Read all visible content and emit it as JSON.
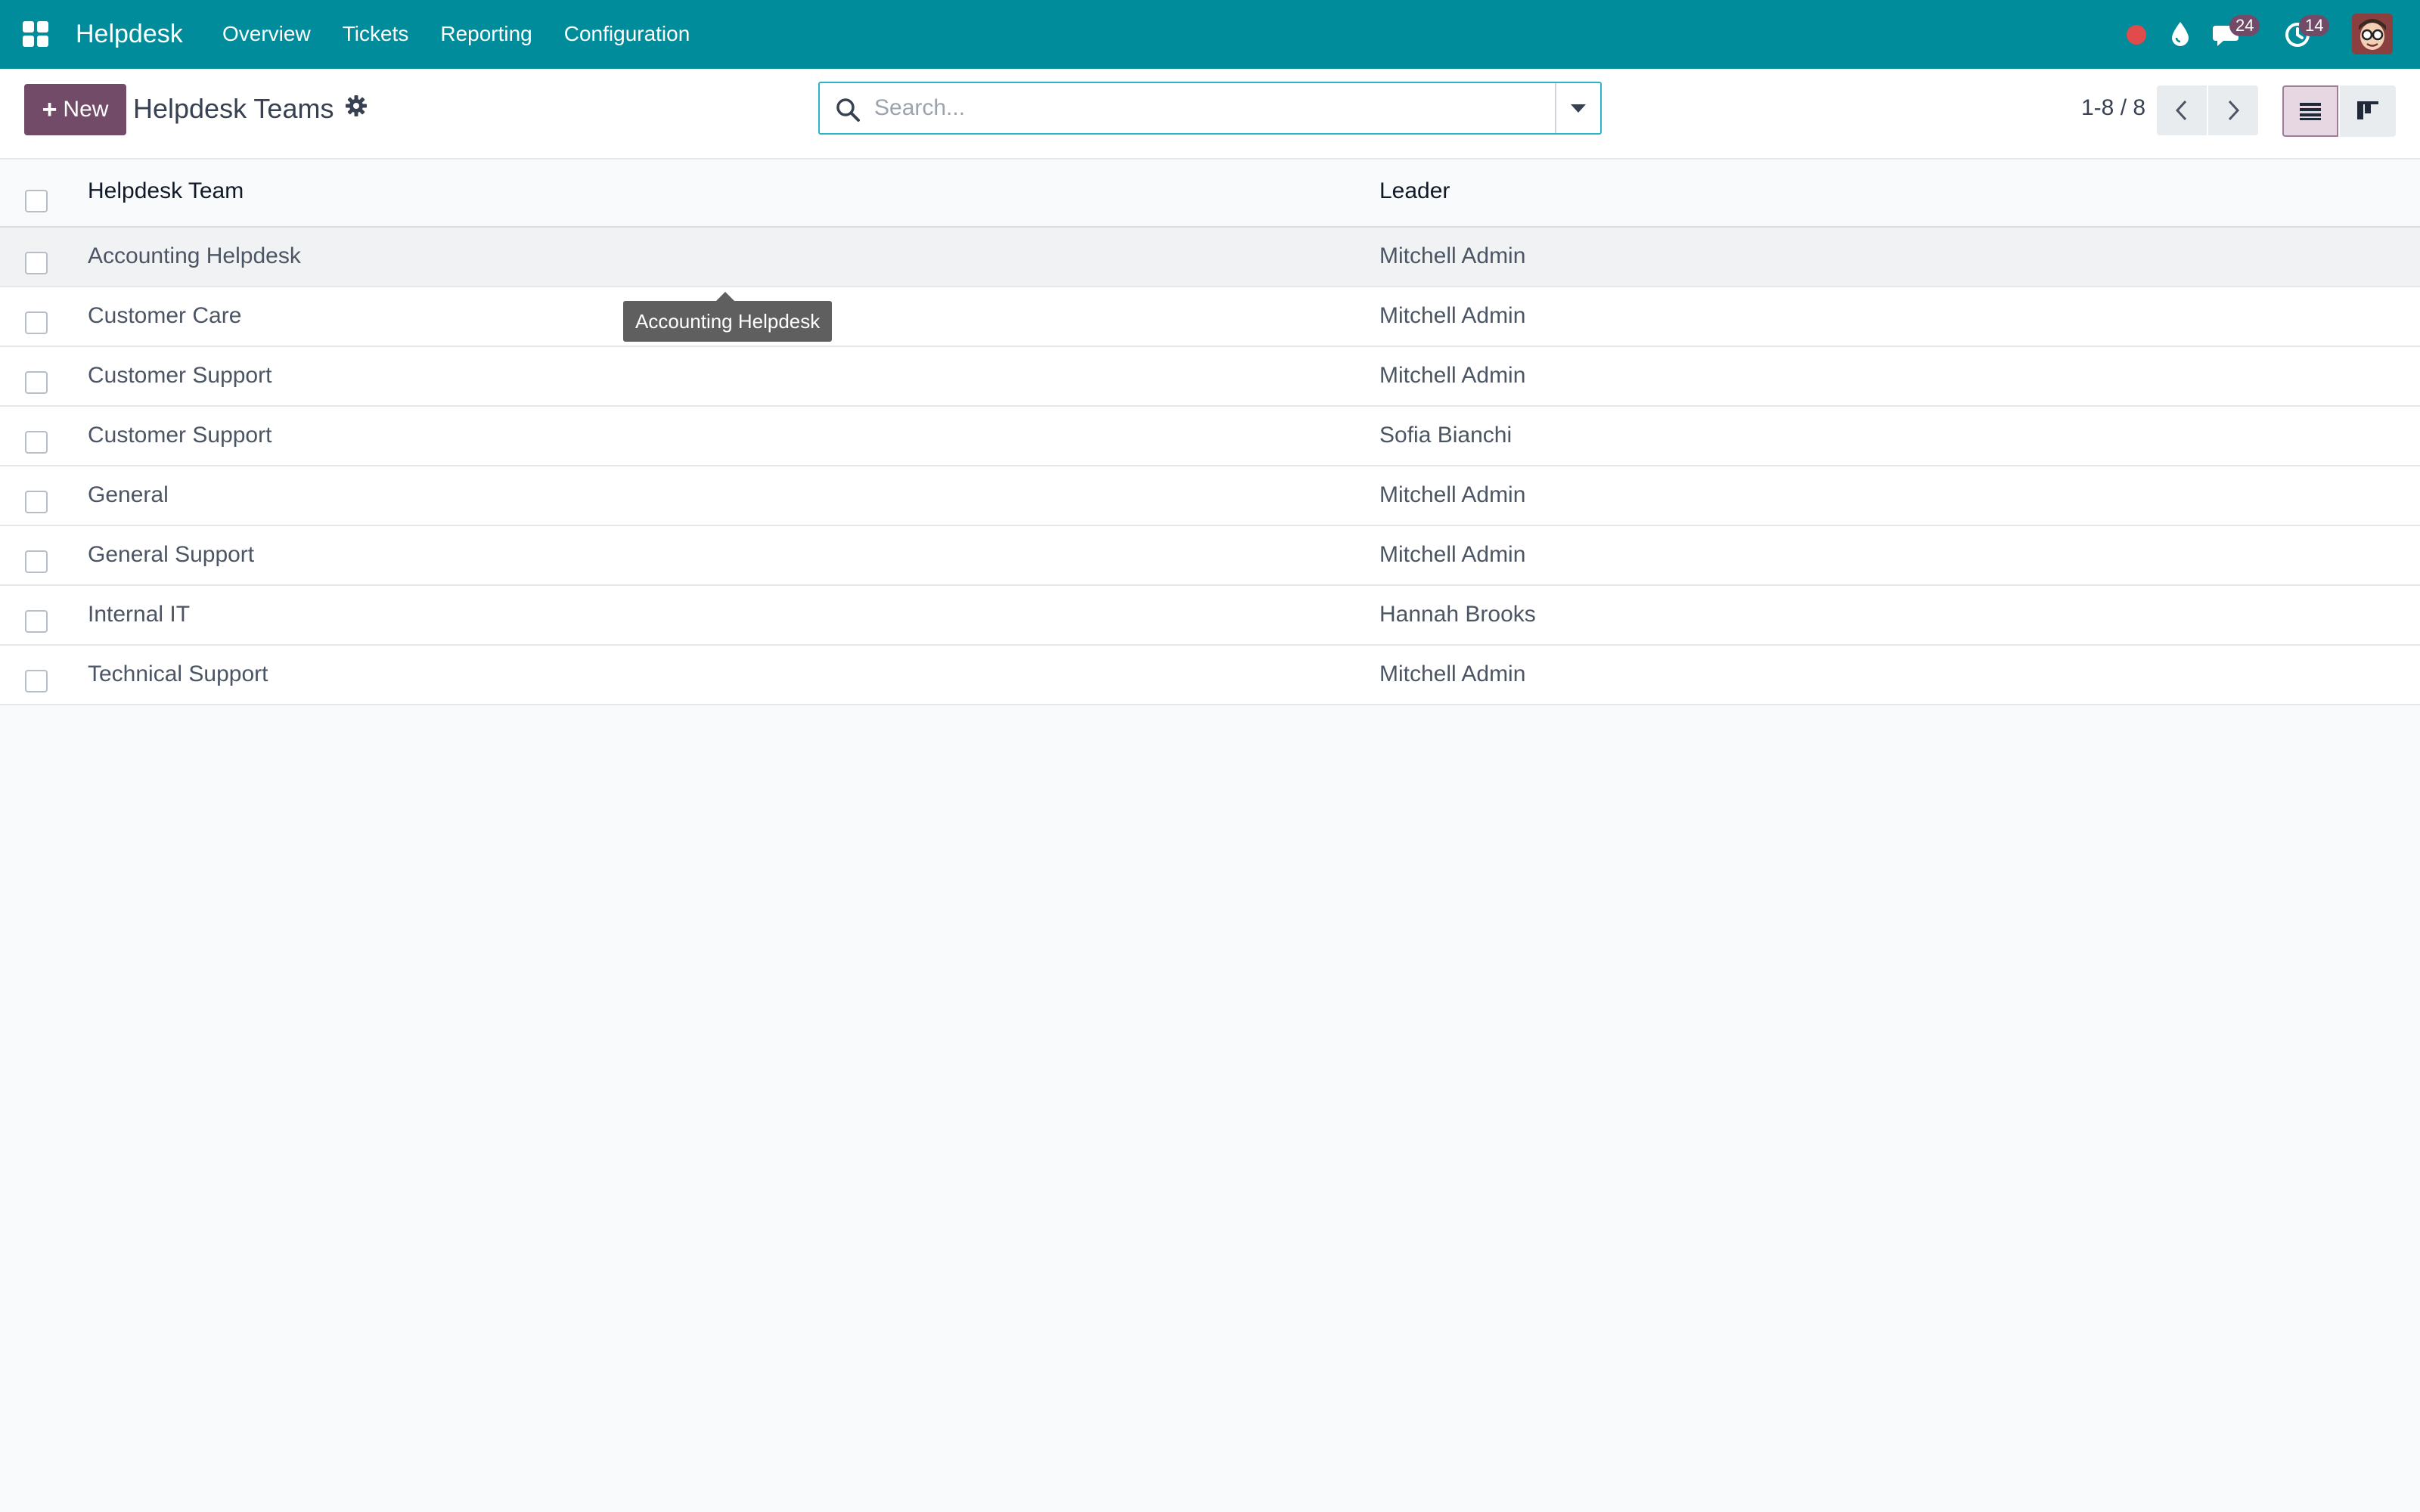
{
  "navbar": {
    "brand": "Helpdesk",
    "menu": [
      "Overview",
      "Tickets",
      "Reporting",
      "Configuration"
    ],
    "messages_badge": "24",
    "activities_badge": "14"
  },
  "control_panel": {
    "new_label": "New",
    "title": "Helpdesk Teams",
    "search_placeholder": "Search...",
    "pager": "1-8 / 8"
  },
  "table": {
    "columns": [
      "Helpdesk Team",
      "Leader"
    ],
    "rows": [
      {
        "team": "Accounting Helpdesk",
        "leader": "Mitchell Admin"
      },
      {
        "team": "Customer Care",
        "leader": "Mitchell Admin"
      },
      {
        "team": "Customer Support",
        "leader": "Mitchell Admin"
      },
      {
        "team": "Customer Support",
        "leader": "Sofia Bianchi"
      },
      {
        "team": "General",
        "leader": "Mitchell Admin"
      },
      {
        "team": "General Support",
        "leader": "Mitchell Admin"
      },
      {
        "team": "Internal IT",
        "leader": "Hannah Brooks"
      },
      {
        "team": "Technical Support",
        "leader": "Mitchell Admin"
      }
    ]
  },
  "tooltip": {
    "text": "Accounting Helpdesk"
  },
  "colors": {
    "navbar": "#018c9b",
    "primary": "#714b67",
    "search_focus": "#2bb5c4",
    "recording": "#e04b4b"
  },
  "icons": [
    "apps-icon",
    "recording-dot-icon",
    "drop-icon",
    "chat-icon",
    "clock-icon",
    "gear-icon",
    "search-icon",
    "caret-down-icon",
    "chevron-left-icon",
    "chevron-right-icon",
    "list-view-icon",
    "kanban-view-icon"
  ]
}
